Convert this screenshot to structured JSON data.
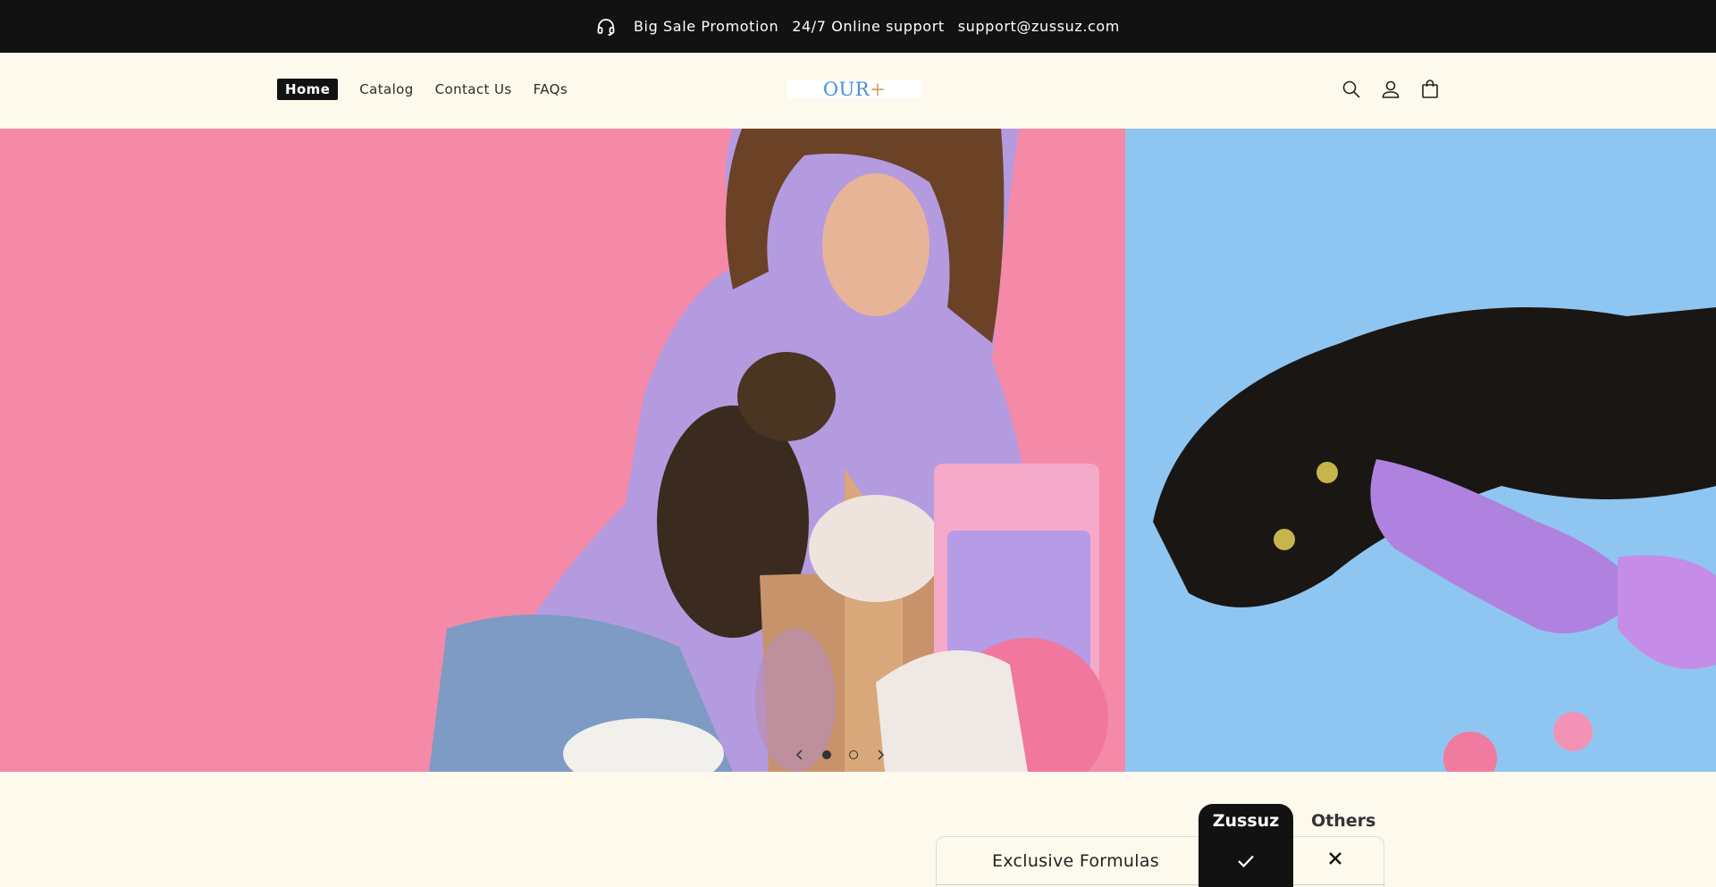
{
  "announcement": {
    "icon": "headset-icon",
    "promo": "Big Sale Promotion",
    "support": "24/7 Online support",
    "email": "support@zussuz.com"
  },
  "nav": {
    "items": [
      {
        "label": "Home",
        "active": true
      },
      {
        "label": "Catalog",
        "active": false
      },
      {
        "label": "Contact Us",
        "active": false
      },
      {
        "label": "FAQs",
        "active": false
      }
    ]
  },
  "logo": {
    "text": "OUR",
    "mark": "+"
  },
  "header_icons": [
    "search-icon",
    "account-icon",
    "cart-icon"
  ],
  "hero": {
    "slide_count": 2,
    "current_slide": 1,
    "colors": {
      "left_bg": "#f48aa8",
      "right_bg": "#8fc6f1"
    }
  },
  "comparison": {
    "row_label": "Exclusive Formulas",
    "col_ours": "Zussuz",
    "col_others": "Others",
    "ours_value": "check-icon",
    "others_value": "x-icon"
  }
}
